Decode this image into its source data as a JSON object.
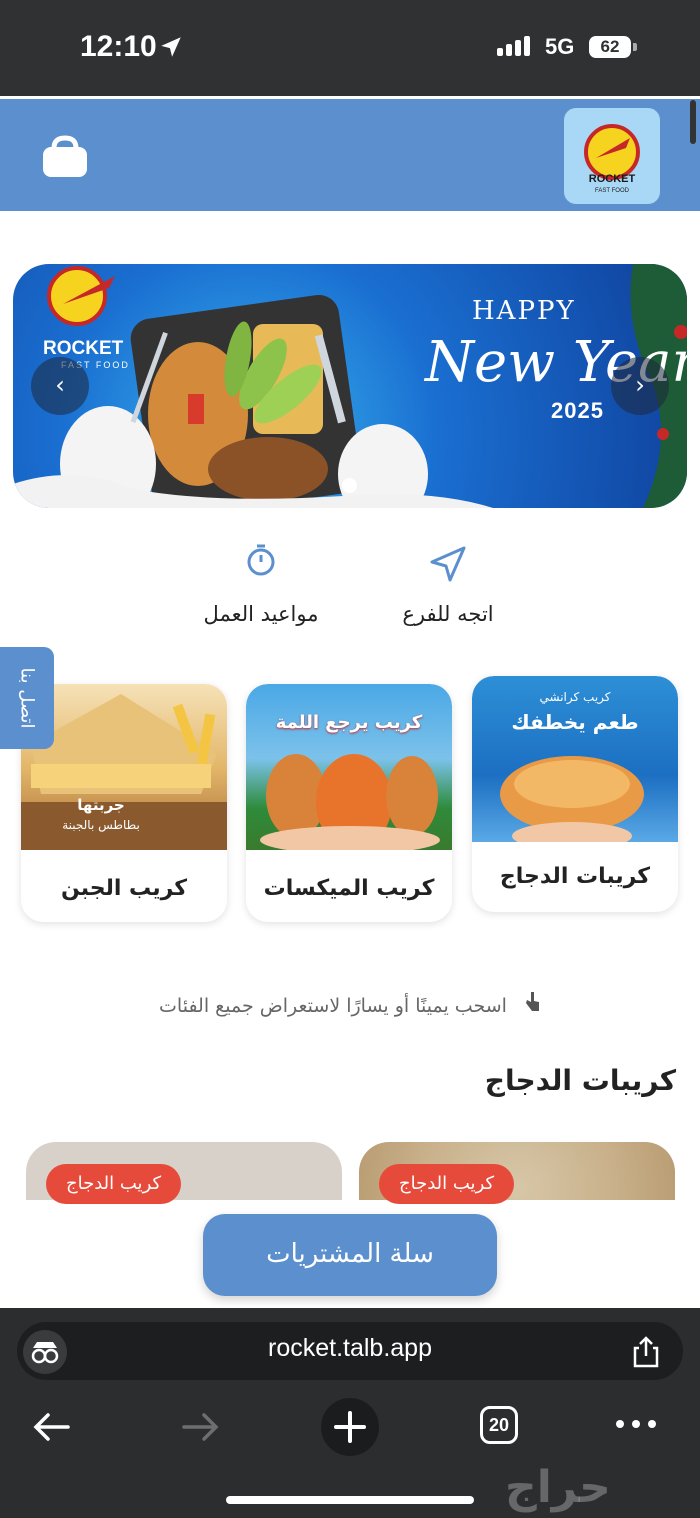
{
  "status_bar": {
    "time": "12:10",
    "network": "5G",
    "battery": "62"
  },
  "header": {
    "logo_top": "ROCKET",
    "logo_sub": "FAST FOOD"
  },
  "banner": {
    "brand_top": "ROCKET",
    "brand_sub": "FAST FOOD",
    "greeting_line1": "HAPPY",
    "greeting_line2": "New Year",
    "year": "2025",
    "prev_glyph": "‹",
    "next_glyph": "›"
  },
  "quick_actions": [
    {
      "label": "اتجه للفرع",
      "icon": "navigation-icon"
    },
    {
      "label": "مواعيد العمل",
      "icon": "clock-icon"
    }
  ],
  "contact_tab": {
    "label": "اتصل بنا"
  },
  "categories": [
    {
      "label": "كريبات الدجاج",
      "image_caption_1": "كريب كرانشي",
      "image_caption_2": "طعم يخطفك"
    },
    {
      "label": "كريب الميكسات",
      "image_caption_1": "كريب يرجع اللمة"
    },
    {
      "label": "كريب الجبن",
      "image_caption_1": "جربتها",
      "image_caption_2": "بطاطس بالجبنة"
    }
  ],
  "swipe_hint": "اسحب يمينًا أو يسارًا لاستعراض جميع الفئات",
  "section_title": "كريبات الدجاج",
  "products": [
    {
      "badge": "كريب الدجاج"
    },
    {
      "badge": "كريب الدجاج"
    }
  ],
  "cart_button": "سلة المشتريات",
  "browser": {
    "url": "rocket.talb.app",
    "tab_count": "20"
  },
  "watermark": "حراج",
  "colors": {
    "primary": "#5b8fcd",
    "badge": "#e64a3b",
    "logo_bg": "#a8d8f5"
  }
}
